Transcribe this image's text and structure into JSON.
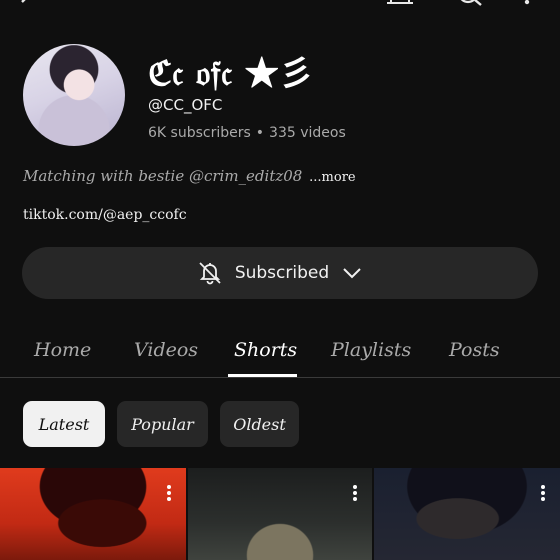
{
  "channel": {
    "name": "ℭ𝔠 𝔬𝔣𝔠 ★彡",
    "handle": "@CC_OFC",
    "subscribers": "6K subscribers",
    "videos": "335 videos",
    "separator": "•",
    "description": "Matching with bestie @crim_editz08",
    "description_more": "...more",
    "link": "tiktok.com/@aep_ccofc"
  },
  "subscribe": {
    "label": "Subscribed",
    "icon": "bell-off-icon",
    "chevron": "chevron-down-icon"
  },
  "tabs": [
    {
      "label": "Home",
      "active": false
    },
    {
      "label": "Videos",
      "active": false
    },
    {
      "label": "Shorts",
      "active": true
    },
    {
      "label": "Playlists",
      "active": false
    },
    {
      "label": "Posts",
      "active": false
    }
  ],
  "filters": [
    {
      "label": "Latest",
      "active": true
    },
    {
      "label": "Popular",
      "active": false
    },
    {
      "label": "Oldest",
      "active": false
    }
  ],
  "colors": {
    "background": "#0f0f0f",
    "chip_active": "#f1f1f1",
    "chip_inactive": "#272727",
    "secondary_text": "#aaaaaa"
  }
}
